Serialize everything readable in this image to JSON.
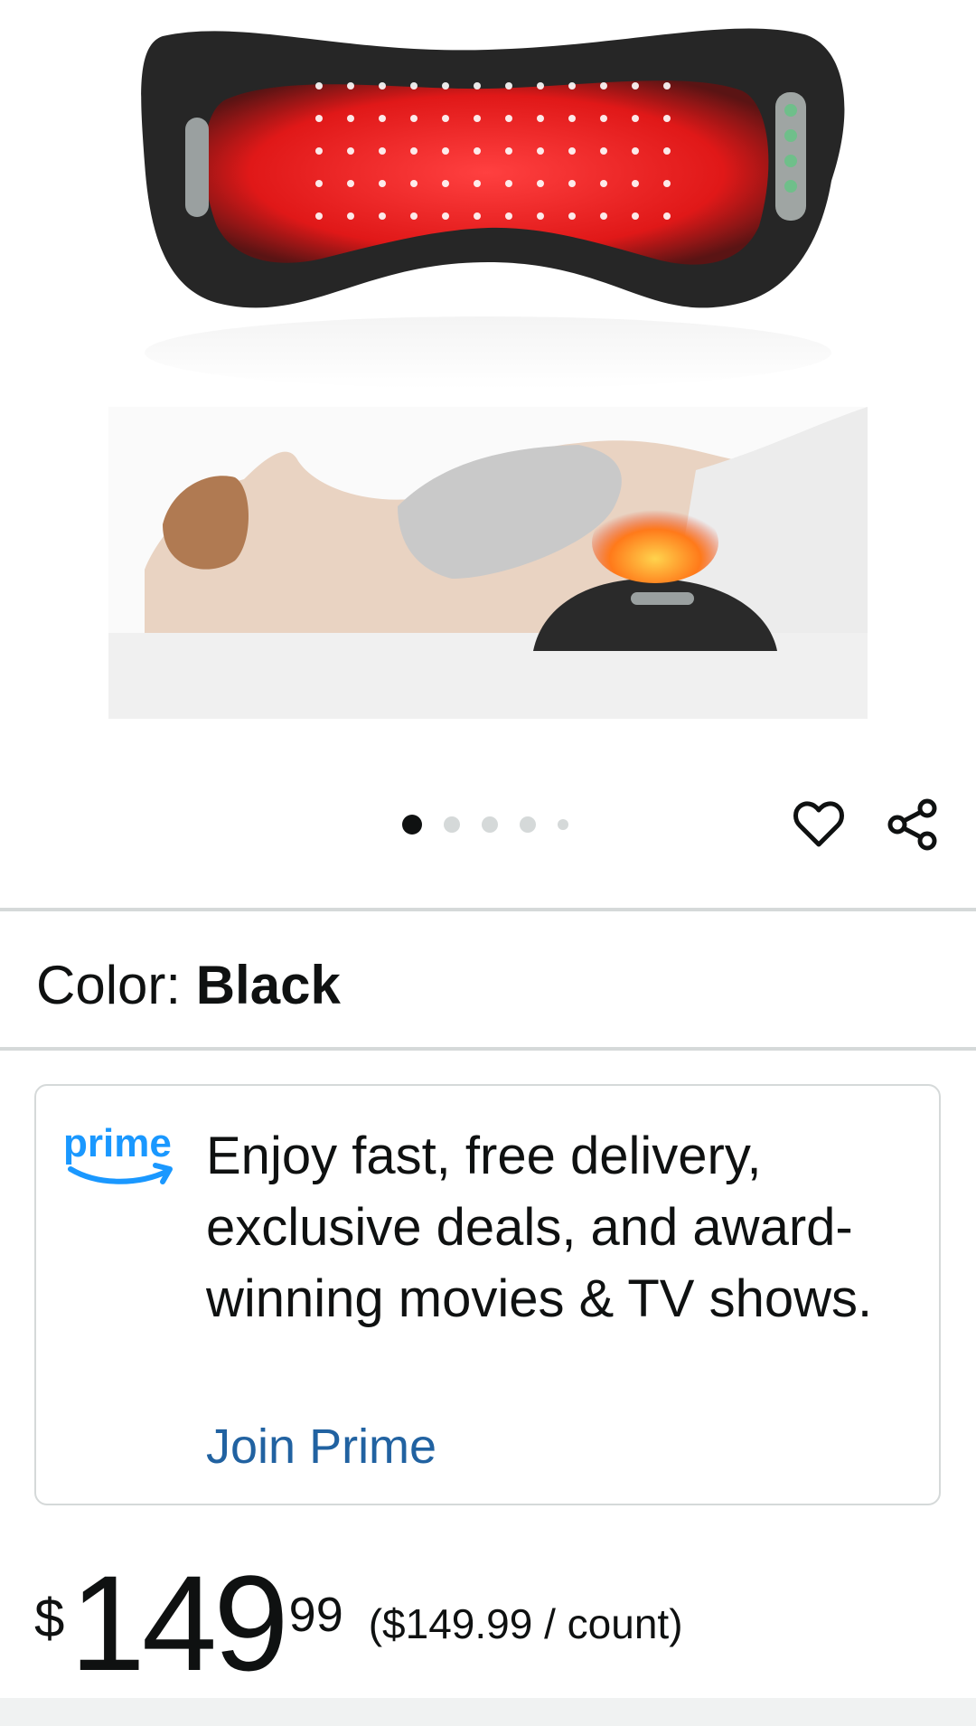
{
  "gallery": {
    "image_alt": "Red light therapy back massager",
    "dot_count": 5,
    "active_index": 0
  },
  "actions": {
    "heart_icon": "heart-icon",
    "share_icon": "share-icon"
  },
  "variation": {
    "label": "Color: ",
    "value": "Black"
  },
  "prime": {
    "logo_text": "prime",
    "message": "Enjoy fast, free delivery, exclusive deals, and award-winning movies & TV shows.",
    "link": "Join Prime"
  },
  "price": {
    "symbol": "$",
    "whole": "149",
    "fraction": "99",
    "unit": "($149.99 / count)"
  },
  "colors": {
    "link": "#2162a1",
    "prime_blue": "#1a98ff",
    "divider": "#d5d9d9",
    "text": "#0f1111"
  }
}
